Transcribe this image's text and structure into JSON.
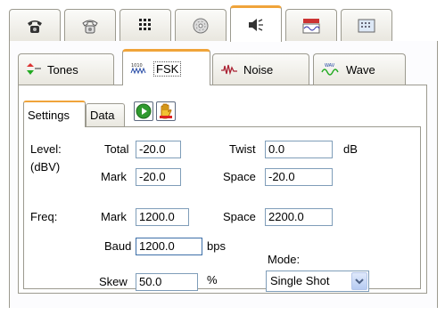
{
  "top_tabs": [
    {
      "icon": "telephone-icon"
    },
    {
      "icon": "rotary-phone-icon"
    },
    {
      "icon": "keypad-icon"
    },
    {
      "icon": "disc-icon"
    },
    {
      "icon": "speaker-icon",
      "active": true
    },
    {
      "icon": "waveform-meter-icon"
    },
    {
      "icon": "grid-display-icon"
    }
  ],
  "sub_tabs": [
    {
      "label": "Tones",
      "icon": "tones-icon"
    },
    {
      "label": "FSK",
      "icon": "fsk-icon",
      "active": true
    },
    {
      "label": "Noise",
      "icon": "noise-icon"
    },
    {
      "label": "Wave",
      "icon": "wave-icon"
    }
  ],
  "settings_tabs": {
    "settings": "Settings",
    "data": "Data"
  },
  "controls": {
    "play_icon": "play-icon",
    "stop_icon": "hand-stop-icon"
  },
  "form": {
    "level_label": "Level:",
    "level_unit_label": "(dBV)",
    "freq_label": "Freq:",
    "total_label": "Total",
    "total_value": "-20.0",
    "twist_label": "Twist",
    "twist_value": "0.0",
    "db_label": "dB",
    "mark_label": "Mark",
    "mark_level_value": "-20.0",
    "space_label": "Space",
    "space_level_value": "-20.0",
    "mark_freq_value": "1200.0",
    "space_freq_value": "2200.0",
    "baud_label": "Baud",
    "baud_value": "1200.0",
    "bps_label": "bps",
    "skew_label": "Skew",
    "skew_value": "50.0",
    "percent_label": "%",
    "mode_label": "Mode:",
    "mode_value": "Single Shot"
  },
  "colors": {
    "accent": "#f0a43a",
    "border": "#9c9a8f",
    "input_border": "#7f9db9"
  }
}
